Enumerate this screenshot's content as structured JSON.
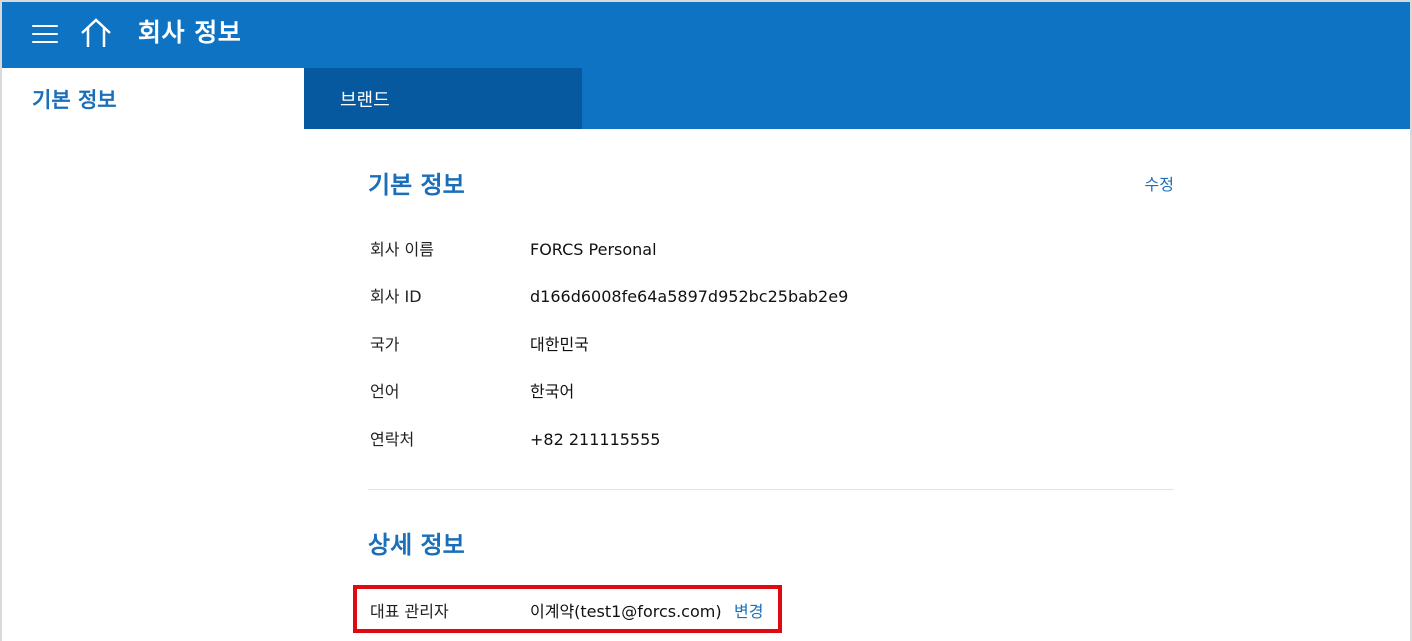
{
  "header": {
    "title": "회사 정보",
    "menu_icon": "hamburger-menu-icon",
    "home_icon": "home-icon"
  },
  "tabs": [
    {
      "label": "기본 정보",
      "active": true
    },
    {
      "label": "브랜드",
      "active": false
    }
  ],
  "basic_info": {
    "title": "기본 정보",
    "edit_label": "수정",
    "rows": [
      {
        "label": "회사 이름",
        "value": "FORCS Personal"
      },
      {
        "label": "회사 ID",
        "value": "d166d6008fe64a5897d952bc25bab2e9"
      },
      {
        "label": "국가",
        "value": "대한민국"
      },
      {
        "label": "언어",
        "value": "한국어"
      },
      {
        "label": "연락처",
        "value": "+82 211115555"
      }
    ]
  },
  "detail_info": {
    "title": "상세 정보",
    "admin": {
      "label": "대표 관리자",
      "value": "이계약(test1@forcs.com)",
      "change_label": "변경"
    }
  },
  "colors": {
    "primary": "#0f73c4",
    "tab_dark": "#06599e",
    "link": "#1a6fb8",
    "highlight": "#e0090f"
  }
}
